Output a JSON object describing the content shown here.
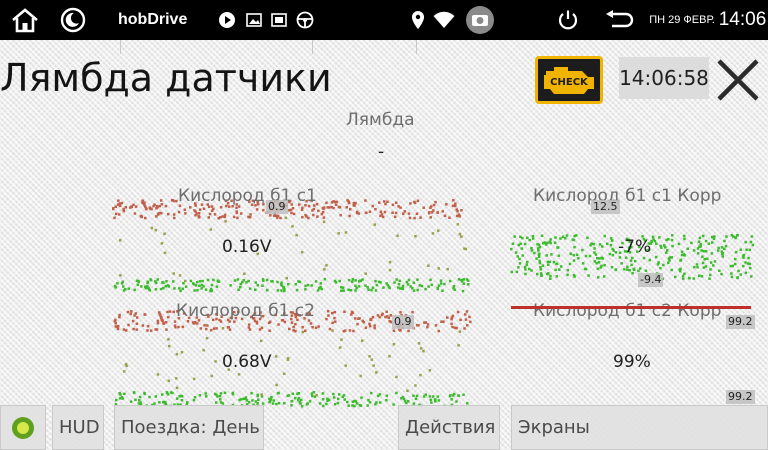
{
  "status_bar": {
    "app_name": "hobDrive",
    "date": "ПН 29 ФЕВР.",
    "time": "14:06",
    "icons": [
      "home-icon",
      "moon-icon",
      "play-icon",
      "image-icon",
      "tablet-icon",
      "steering-wheel-icon",
      "location-icon",
      "wifi-icon",
      "camera-icon",
      "power-icon",
      "back-icon"
    ]
  },
  "header": {
    "title": "Лямбда датчики",
    "check_label": "CHECK",
    "clock": "14:06:58"
  },
  "gauges": {
    "lambda": {
      "label": "Лямбда",
      "value": "-"
    },
    "o2_b1s1": {
      "label": "Кислород б1 с1",
      "value": "0.16V",
      "marker": "0.9"
    },
    "o2_b1s1_trim": {
      "label": "Кислород б1 с1 Корр",
      "value": "-7%",
      "marker_top": "12.5",
      "marker_bottom": "-9.4"
    },
    "o2_b1s2": {
      "label": "Кислород б1 с2",
      "value": "0.68V",
      "marker": "0.9"
    },
    "o2_b1s2_trim": {
      "label": "Кислород б1 с2 Корр",
      "value": "99%",
      "marker_top": "99.2",
      "marker_bottom": "99.2"
    }
  },
  "colors": {
    "scatter_red": "#c0604a",
    "scatter_green": "#3dbb2e",
    "scatter_olive": "#9aa04a",
    "alert_line": "#c0302a",
    "check_border": "#f0b400",
    "check_text": "#f0b400"
  },
  "bottom_bar": {
    "hud_label": "HUD",
    "trip_label": "Поездка: День",
    "actions_label": "Действия",
    "screens_label": "Экраны"
  }
}
